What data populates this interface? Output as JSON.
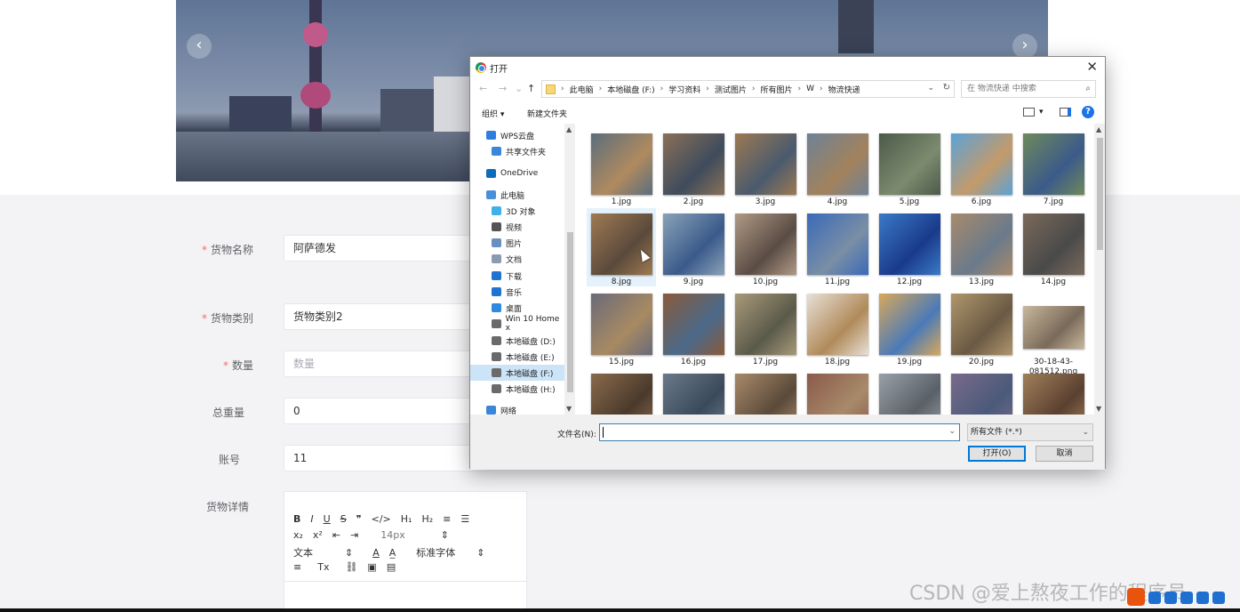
{
  "banner": {
    "prev_arrow": "‹",
    "next_arrow": "›"
  },
  "form": {
    "fields": [
      {
        "label": "货物名称",
        "required": true,
        "value": "阿萨德发",
        "placeholder": ""
      },
      {
        "label": "货物类别",
        "required": true,
        "value": "货物类别2",
        "placeholder": ""
      },
      {
        "label": "数量",
        "required": true,
        "value": "",
        "placeholder": "数量"
      },
      {
        "label": "总重量",
        "required": false,
        "value": "0",
        "placeholder": ""
      },
      {
        "label": "账号",
        "required": false,
        "value": "11",
        "placeholder": ""
      }
    ],
    "details_label": "货物详情",
    "editor": {
      "row1": [
        "B",
        "I",
        "U",
        "S",
        "❞",
        "</>",
        "H₁",
        "H₂",
        "≡",
        "☰"
      ],
      "row2": [
        "x₂",
        "x²",
        "⇤",
        "⇥"
      ],
      "font_size": "14px",
      "row3_text": "文本",
      "font_color": "A",
      "font_family": "标准字体",
      "row4": [
        "≡",
        "Tx",
        "🔗",
        "▣",
        "▤"
      ]
    }
  },
  "watermark": "CSDN @爱上熬夜工作的程序员",
  "dialog": {
    "title": "打开",
    "close": "✕",
    "breadcrumb": [
      "此电脑",
      "本地磁盘 (F:)",
      "学习资料",
      "测试图片",
      "所有图片",
      "W",
      "物流快递"
    ],
    "search_placeholder": "在 物流快递 中搜索",
    "toolbar": {
      "organize": "组织 ▾",
      "new_folder": "新建文件夹",
      "help": "?"
    },
    "nav_items": [
      {
        "label": "WPS云盘",
        "icon": "cloud-icon",
        "color": "#2f7de1"
      },
      {
        "label": "共享文件夹",
        "icon": "shared-folder-icon",
        "color": "#3a86d8"
      },
      {
        "label": "OneDrive",
        "icon": "onedrive-icon",
        "color": "#0f6cbd"
      },
      {
        "label": "此电脑",
        "icon": "computer-icon",
        "color": "#4a90d9"
      },
      {
        "label": "3D 对象",
        "icon": "3d-objects-icon",
        "color": "#3fb0e8"
      },
      {
        "label": "视频",
        "icon": "video-icon",
        "color": "#555555"
      },
      {
        "label": "图片",
        "icon": "pictures-icon",
        "color": "#6a8fbf"
      },
      {
        "label": "文档",
        "icon": "documents-icon",
        "color": "#8a9bb0"
      },
      {
        "label": "下载",
        "icon": "download-icon",
        "color": "#1e74d0"
      },
      {
        "label": "音乐",
        "icon": "music-icon",
        "color": "#1e74d0"
      },
      {
        "label": "桌面",
        "icon": "desktop-icon",
        "color": "#2d8ae0"
      },
      {
        "label": "Win 10 Home x",
        "icon": "drive-icon",
        "color": "#6a6a6a"
      },
      {
        "label": "本地磁盘 (D:)",
        "icon": "drive-icon",
        "color": "#6a6a6a"
      },
      {
        "label": "本地磁盘 (E:)",
        "icon": "drive-icon",
        "color": "#6a6a6a"
      },
      {
        "label": "本地磁盘 (F:)",
        "icon": "drive-icon",
        "color": "#6a6a6a",
        "selected": true
      },
      {
        "label": "本地磁盘 (H:)",
        "icon": "drive-icon",
        "color": "#6a6a6a"
      },
      {
        "label": "网络",
        "icon": "network-icon",
        "color": "#3a86d8"
      }
    ],
    "files": [
      {
        "name": "1.jpg",
        "colors": [
          "#5b6e7d",
          "#b08a5e"
        ]
      },
      {
        "name": "2.jpg",
        "colors": [
          "#8a7058",
          "#3e4c5c"
        ]
      },
      {
        "name": "3.jpg",
        "colors": [
          "#9c7a52",
          "#4a5a6e"
        ]
      },
      {
        "name": "4.jpg",
        "colors": [
          "#6e8296",
          "#a3825c"
        ]
      },
      {
        "name": "5.jpg",
        "colors": [
          "#4c5b4a",
          "#7c8a6e"
        ]
      },
      {
        "name": "6.jpg",
        "colors": [
          "#5aa3d8",
          "#c49a6a"
        ]
      },
      {
        "name": "7.jpg",
        "colors": [
          "#6e8a5a",
          "#3c5a8a"
        ]
      },
      {
        "name": "8.jpg",
        "colors": [
          "#a07a52",
          "#5a4a3c"
        ]
      },
      {
        "name": "9.jpg",
        "colors": [
          "#8aa2b8",
          "#3a5a8a"
        ]
      },
      {
        "name": "10.jpg",
        "colors": [
          "#b09a86",
          "#5a4c44"
        ]
      },
      {
        "name": "11.jpg",
        "colors": [
          "#3a6ab8",
          "#7a8ea6"
        ]
      },
      {
        "name": "12.jpg",
        "colors": [
          "#3a7ac8",
          "#1a3a8a"
        ]
      },
      {
        "name": "13.jpg",
        "colors": [
          "#a88a6c",
          "#6a7a8a"
        ]
      },
      {
        "name": "14.jpg",
        "colors": [
          "#7a6a5a",
          "#4a4a4a"
        ]
      },
      {
        "name": "15.jpg",
        "colors": [
          "#6a6a7a",
          "#a88a62"
        ]
      },
      {
        "name": "16.jpg",
        "colors": [
          "#8a5a3a",
          "#4a6a8a"
        ]
      },
      {
        "name": "17.jpg",
        "colors": [
          "#a89a7a",
          "#5a5a4a"
        ]
      },
      {
        "name": "18.jpg",
        "colors": [
          "#e8e0d6",
          "#b08a5a"
        ]
      },
      {
        "name": "19.jpg",
        "colors": [
          "#d8a85a",
          "#4a7ab8"
        ]
      },
      {
        "name": "20.jpg",
        "colors": [
          "#b0966c",
          "#6a5a44"
        ]
      },
      {
        "name": "30-18-43-081512.png",
        "colors": [
          "#c8b89c",
          "#7a6a5a"
        ]
      },
      {
        "name": "",
        "colors": [
          "#8a6a4c",
          "#4a3a2c"
        ]
      },
      {
        "name": "",
        "colors": [
          "#6a7a8a",
          "#3a4a5a"
        ]
      },
      {
        "name": "",
        "colors": [
          "#a88a6a",
          "#5a4a3a"
        ]
      },
      {
        "name": "",
        "colors": [
          "#8a5a4a",
          "#a88a6a"
        ]
      },
      {
        "name": "",
        "colors": [
          "#9aa0a8",
          "#5a6068"
        ]
      },
      {
        "name": "",
        "colors": [
          "#7a6a8a",
          "#4a5a7a"
        ]
      },
      {
        "name": "",
        "colors": [
          "#a0805a",
          "#5a4030"
        ]
      }
    ],
    "filename_label": "文件名(N):",
    "filename_value": "",
    "filetype": "所有文件 (*.*)",
    "open_button": "打开(O)",
    "cancel_button": "取消"
  }
}
